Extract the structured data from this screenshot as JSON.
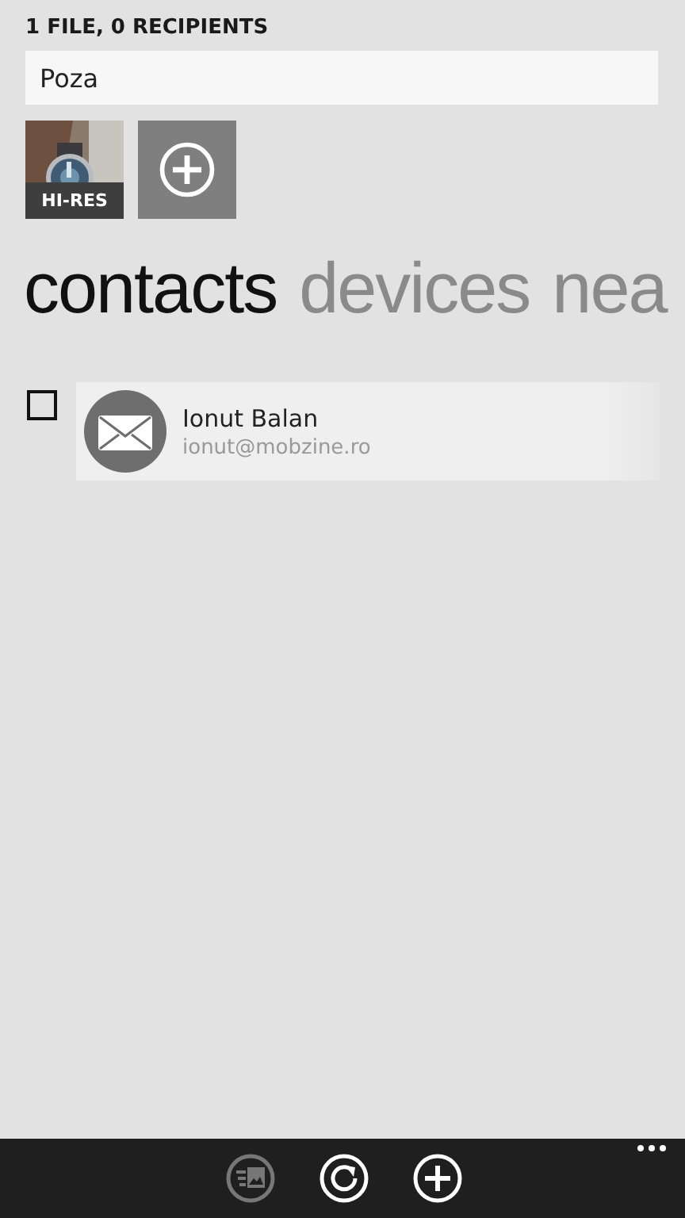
{
  "header": "1 FILE, 0 RECIPIENTS",
  "message": {
    "value": "Poza"
  },
  "attachments": [
    {
      "kind": "picture",
      "label": "HI-RES"
    },
    {
      "kind": "add"
    }
  ],
  "pivots": [
    {
      "label": "contacts",
      "selected": true
    },
    {
      "label": "devices",
      "selected": false
    },
    {
      "label": "nea",
      "selected": false
    }
  ],
  "contacts": [
    {
      "name": "Ionut Balan",
      "email": "ionut@mobzine.ro",
      "checked": false
    }
  ],
  "app_bar": {
    "buttons": [
      {
        "kind": "send",
        "disabled": true
      },
      {
        "kind": "refresh",
        "disabled": false
      },
      {
        "kind": "add",
        "disabled": false
      }
    ],
    "more": true
  }
}
